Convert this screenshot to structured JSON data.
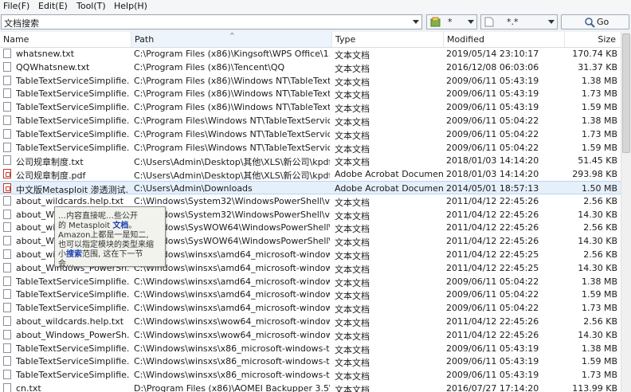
{
  "menu": [
    "File(F)",
    "Edit(E)",
    "Tool(T)",
    "Help(H)"
  ],
  "search": {
    "value": "文档搜索"
  },
  "filter1": {
    "value": "*"
  },
  "filter2": {
    "value": "*.*"
  },
  "go_label": "Go",
  "columns": [
    "Name",
    "Path",
    "Type",
    "Modified",
    "Size"
  ],
  "rows": [
    {
      "name": "whatsnew.txt",
      "path": "C:\\Program Files (x86)\\Kingsoft\\WPS Office\\1...",
      "type": "文本文档",
      "modified": "2019/05/14  23:10:17",
      "size": "170.74 KB",
      "icon": "text-file-icon"
    },
    {
      "name": "QQWhatsnew.txt",
      "path": "C:\\Program Files (x86)\\Tencent\\QQ",
      "type": "文本文档",
      "modified": "2016/12/08  06:03:06",
      "size": "31.37 KB",
      "icon": "text-file-icon"
    },
    {
      "name": "TableTextServiceSimplifie...",
      "path": "C:\\Program Files (x86)\\Windows NT\\TableText...",
      "type": "文本文档",
      "modified": "2009/06/11  05:43:19",
      "size": "1.38 MB",
      "icon": "text-file-icon"
    },
    {
      "name": "TableTextServiceSimplifie...",
      "path": "C:\\Program Files (x86)\\Windows NT\\TableText...",
      "type": "文本文档",
      "modified": "2009/06/11  05:43:19",
      "size": "1.73 MB",
      "icon": "text-file-icon"
    },
    {
      "name": "TableTextServiceSimplifie...",
      "path": "C:\\Program Files (x86)\\Windows NT\\TableText...",
      "type": "文本文档",
      "modified": "2009/06/11  05:43:19",
      "size": "1.59 MB",
      "icon": "text-file-icon"
    },
    {
      "name": "TableTextServiceSimplifie...",
      "path": "C:\\Program Files\\Windows NT\\TableTextService",
      "type": "文本文档",
      "modified": "2009/06/11  05:04:22",
      "size": "1.38 MB",
      "icon": "text-file-icon"
    },
    {
      "name": "TableTextServiceSimplifie...",
      "path": "C:\\Program Files\\Windows NT\\TableTextService",
      "type": "文本文档",
      "modified": "2009/06/11  05:04:22",
      "size": "1.73 MB",
      "icon": "text-file-icon"
    },
    {
      "name": "TableTextServiceSimplifie...",
      "path": "C:\\Program Files\\Windows NT\\TableTextService",
      "type": "文本文档",
      "modified": "2009/06/11  05:04:22",
      "size": "1.59 MB",
      "icon": "text-file-icon"
    },
    {
      "name": "公司规章制度.txt",
      "path": "C:\\Users\\Admin\\Desktop\\其他\\XLS\\新公司\\kpdf",
      "type": "文本文档",
      "modified": "2018/01/03  14:14:20",
      "size": "51.45 KB",
      "icon": "text-file-icon"
    },
    {
      "name": "公司规章制度.pdf",
      "path": "C:\\Users\\Admin\\Desktop\\其他\\XLS\\新公司\\kpdf",
      "type": "Adobe Acrobat Document",
      "modified": "2018/01/03  14:14:20",
      "size": "293.98 KB",
      "icon": "pdf-file-icon"
    },
    {
      "name": "中文版Metasploit 渗透测试...",
      "path": "C:\\Users\\Admin\\Downloads",
      "type": "Adobe Acrobat Document",
      "modified": "2014/05/01  18:57:13",
      "size": "1.50 MB",
      "icon": "pdf-file-icon",
      "selected": true
    },
    {
      "name": "about_wildcards.help.txt",
      "path": "C:\\Windows\\System32\\WindowsPowerShell\\v1...",
      "type": "文本文档",
      "modified": "2011/04/12  22:45:26",
      "size": "2.56 KB",
      "icon": "text-file-icon"
    },
    {
      "name": "about_Wi",
      "path": "C:\\Windows\\System32\\WindowsPowerShell\\v1...",
      "type": "文本文档",
      "modified": "2011/04/12  22:45:26",
      "size": "14.30 KB",
      "icon": "text-file-icon"
    },
    {
      "name": "about_wi",
      "path": "C:\\Windows\\SysWOW64\\WindowsPowerShell\\v1...",
      "type": "文本文档",
      "modified": "2011/04/12  22:45:26",
      "size": "2.56 KB",
      "icon": "text-file-icon"
    },
    {
      "name": "about_Wi",
      "path": "C:\\Windows\\SysWOW64\\WindowsPowerShell\\...",
      "type": "文本文档",
      "modified": "2011/04/12  22:45:26",
      "size": "14.30 KB",
      "icon": "text-file-icon"
    },
    {
      "name": "about_wi",
      "path": "C:\\Windows\\winsxs\\amd64_microsoft-window...",
      "type": "文本文档",
      "modified": "2011/04/12  22:45:25",
      "size": "2.56 KB",
      "icon": "text-file-icon"
    },
    {
      "name": "about_Windows_PowerSh...",
      "path": "C:\\Windows\\winsxs\\amd64_microsoft-window...",
      "type": "文本文档",
      "modified": "2011/04/12  22:45:25",
      "size": "14.30 KB",
      "icon": "text-file-icon"
    },
    {
      "name": "TableTextServiceSimplifie...",
      "path": "C:\\Windows\\winsxs\\amd64_microsoft-window...",
      "type": "文本文档",
      "modified": "2009/06/11  05:04:22",
      "size": "1.38 MB",
      "icon": "text-file-icon"
    },
    {
      "name": "TableTextServiceSimplifie...",
      "path": "C:\\Windows\\winsxs\\amd64_microsoft-window...",
      "type": "文本文档",
      "modified": "2009/06/11  05:04:22",
      "size": "1.59 MB",
      "icon": "text-file-icon"
    },
    {
      "name": "TableTextServiceSimplifie...",
      "path": "C:\\Windows\\winsxs\\amd64_microsoft-window...",
      "type": "文本文档",
      "modified": "2009/06/11  05:04:22",
      "size": "1.73 MB",
      "icon": "text-file-icon"
    },
    {
      "name": "about_wildcards.help.txt",
      "path": "C:\\Windows\\winsxs\\wow64_microsoft-window...",
      "type": "文本文档",
      "modified": "2011/04/12  22:45:26",
      "size": "2.56 KB",
      "icon": "text-file-icon"
    },
    {
      "name": "about_Windows_PowerSh...",
      "path": "C:\\Windows\\winsxs\\wow64_microsoft-window...",
      "type": "文本文档",
      "modified": "2011/04/12  22:45:26",
      "size": "14.30 KB",
      "icon": "text-file-icon"
    },
    {
      "name": "TableTextServiceSimplifie...",
      "path": "C:\\Windows\\winsxs\\x86_microsoft-windows-t....",
      "type": "文本文档",
      "modified": "2009/06/11  05:43:19",
      "size": "1.38 MB",
      "icon": "text-file-icon"
    },
    {
      "name": "TableTextServiceSimplifie...",
      "path": "C:\\Windows\\winsxs\\x86_microsoft-windows-t.i...",
      "type": "文本文档",
      "modified": "2009/06/11  05:43:19",
      "size": "1.59 MB",
      "icon": "text-file-icon"
    },
    {
      "name": "TableTextServiceSimplifie...",
      "path": "C:\\Windows\\winsxs\\x86_microsoft-windows-t.i...",
      "type": "文本文档",
      "modified": "2009/06/11  05:43:19",
      "size": "1.73 MB",
      "icon": "text-file-icon"
    },
    {
      "name": "cn.txt",
      "path": "D:\\Program Files (x86)\\AOMEI Backupper 3.5\\...",
      "type": "文本文档",
      "modified": "2016/07/27  17:14:20",
      "size": "113.99 KB",
      "icon": "text-file-icon"
    }
  ],
  "tooltip": {
    "lines": [
      [
        {
          "t": "…内容直接呢…些公开"
        }
      ],
      [
        {
          "t": "的 Metasploit "
        },
        {
          "t": "文档",
          "b": true
        },
        {
          "t": "。"
        }
      ],
      [
        {
          "t": "Amazon上都是一是知二,"
        }
      ],
      [
        {
          "t": "也可以指定模块的类型来缩"
        }
      ],
      [
        {
          "t": "小"
        },
        {
          "t": "搜索",
          "b": true
        },
        {
          "t": "范围, 这在下一节"
        }
      ],
      [
        {
          "t": "会…"
        }
      ]
    ]
  }
}
